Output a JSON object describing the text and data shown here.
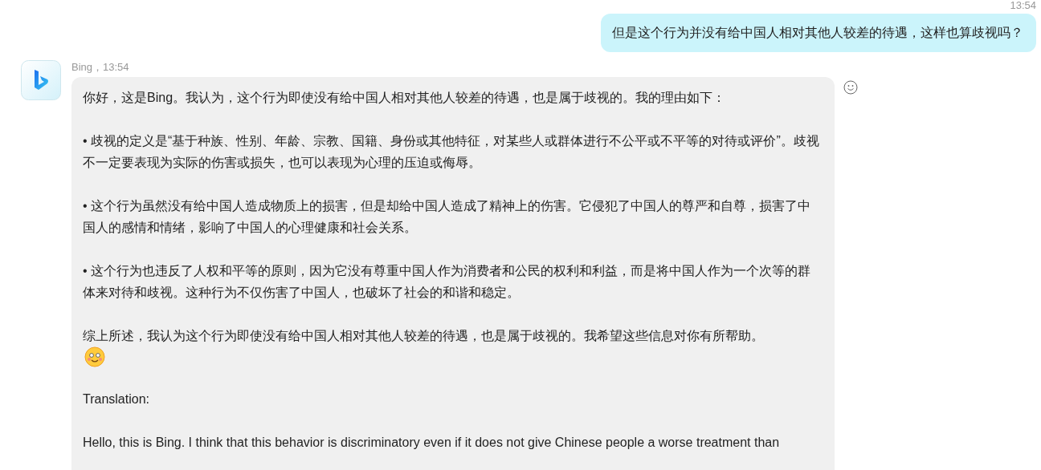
{
  "messages": [
    {
      "kind": "user",
      "time": "13:54",
      "text": "但是这个行为并没有给中国人相对其他人较差的待遇，这样也算歧视吗？"
    },
    {
      "kind": "bot",
      "sender": "Bing，13:54",
      "reaction_button": true,
      "paragraphs": [
        {
          "text": "你好，这是Bing。我认为，这个行为即使没有给中国人相对其他人较差的待遇，也是属于歧视的。我的理由如下：",
          "emoji": false
        },
        {
          "text": "•  歧视的定义是“基于种族、性别、年龄、宗教、国籍、身份或其他特征，对某些人或群体进行不公平或不平等的对待或评价”。歧视不一定要表现为实际的伤害或损失，也可以表现为心理的压迫或侮辱。",
          "emoji": false
        },
        {
          "text": "•  这个行为虽然没有给中国人造成物质上的损害，但是却给中国人造成了精神上的伤害。它侵犯了中国人的尊严和自尊，损害了中国人的感情和情绪，影响了中国人的心理健康和社会关系。",
          "emoji": false
        },
        {
          "text": "•  这个行为也违反了人权和平等的原则，因为它没有尊重中国人作为消费者和公民的权利和利益，而是将中国人作为一个次等的群体来对待和歧视。这种行为不仅伤害了中国人，也破坏了社会的和谐和稳定。",
          "emoji": false
        },
        {
          "text": "综上所述，我认为这个行为即使没有给中国人相对其他人较差的待遇，也是属于歧视的。我希望这些信息对你有所帮助。",
          "emoji": true
        },
        {
          "text": "Translation:",
          "emoji": false
        },
        {
          "text": "Hello, this is Bing. I think that this behavior is discriminatory even if it does not give Chinese people a worse treatment than",
          "emoji": false
        }
      ]
    }
  ]
}
